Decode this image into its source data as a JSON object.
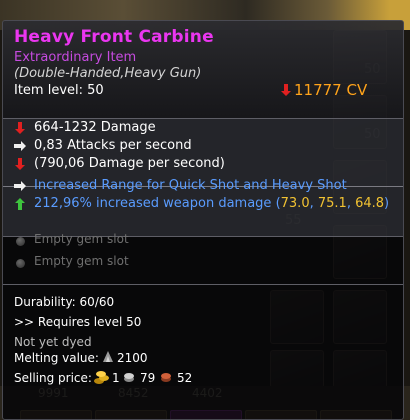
{
  "background": {
    "numbers_mid": [
      "50",
      "50",
      "55"
    ],
    "numbers_bottom": [
      "9991",
      "8452",
      "4402"
    ]
  },
  "tooltip": {
    "title": "Heavy Front Carbine",
    "rarity": "Extraordinary Item",
    "item_type": "(Double-Handed,Heavy Gun)",
    "item_level": "Item level: 50",
    "cv_arrow_icon": "red-down-arrow-icon",
    "cv": "11777 CV",
    "stats": [
      {
        "icon": "red-down-arrow-icon",
        "text": "664-1232 Damage"
      },
      {
        "icon": "white-right-arrow-icon",
        "text": "0,83 Attacks per second"
      },
      {
        "icon": "red-down-arrow-icon",
        "text": "(790,06 Damage per second)"
      },
      {
        "icon": "white-right-arrow-icon",
        "text": "Increased Range for Quick Shot and Heavy Shot"
      },
      {
        "icon": "green-up-arrow-icon",
        "text": "212,96% increased weapon damage",
        "values_open": "(",
        "v1": "73.0",
        "comma1": ", ",
        "v2": "75.1",
        "comma2": ", ",
        "v3": "64.8",
        "values_close": ")"
      }
    ],
    "gem_slots": [
      "Empty gem slot",
      "Empty gem slot"
    ],
    "durability": "Durability: 60/60",
    "requires": ">> Requires level 50",
    "dye": "Not yet dyed",
    "melting_label": "Melting value:",
    "melting_value": "2100",
    "selling_label": "Selling price:",
    "selling_gold": "1",
    "selling_silver": "79",
    "selling_copper": "52",
    "colors": {
      "title": "#ea36f0",
      "rarity": "#c64be0",
      "cv": "#ffa31a",
      "blue_stat": "#5a9cff",
      "yellow_value": "#f1c232"
    }
  }
}
